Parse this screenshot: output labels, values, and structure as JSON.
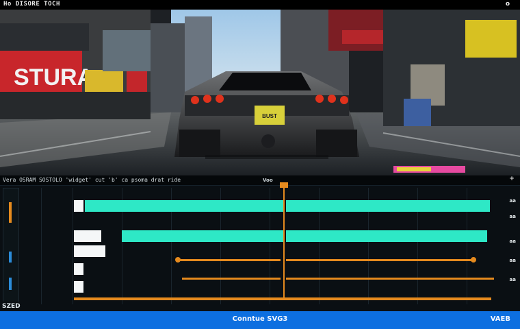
{
  "window": {
    "title": "Ho DISORE TOCH",
    "close_label": "o"
  },
  "viewport": {
    "sign_left": "STURA",
    "plate": "BUST"
  },
  "timeline": {
    "header_label": "Vera OSRAM SOSTOLO 'widget' cut 'b' ca psoma drat ride",
    "ruler_mark": "Voo",
    "add_button": "+",
    "right_labels": [
      "aa",
      "aa",
      "aa",
      "aa",
      "aa"
    ],
    "bottom_left_label": "SZED"
  },
  "footer": {
    "status": "Conntue SVG3",
    "right_label": "VAEB"
  },
  "colors": {
    "accent_clip": "#2ee8c6",
    "keyframe": "#e58a1e",
    "statusbar": "#0d6fe0"
  }
}
